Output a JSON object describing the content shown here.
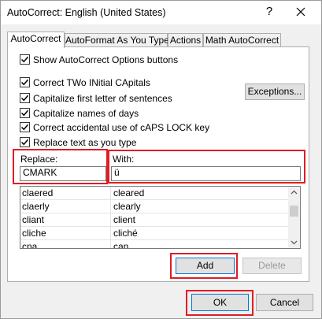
{
  "window": {
    "title": "AutoCorrect: English (United States)",
    "help_glyph": "?"
  },
  "tabs": [
    {
      "label": "AutoCorrect",
      "active": true
    },
    {
      "label": "AutoFormat As You Type",
      "active": false
    },
    {
      "label": "Actions",
      "active": false
    },
    {
      "label": "Math AutoCorrect",
      "active": false
    }
  ],
  "options": {
    "show_buttons": {
      "label": "Show AutoCorrect Options buttons",
      "checked": true
    },
    "two_initial": {
      "label": "Correct TWo INitial CApitals",
      "checked": true
    },
    "first_letter": {
      "label": "Capitalize first letter of sentences",
      "checked": true
    },
    "names_days": {
      "label": "Capitalize names of days",
      "checked": true
    },
    "caps_lock": {
      "label": "Correct accidental use of cAPS LOCK key",
      "checked": true
    },
    "replace_text": {
      "label": "Replace text as you type",
      "checked": true
    }
  },
  "buttons": {
    "exceptions": "Exceptions...",
    "add": "Add",
    "delete": "Delete",
    "ok": "OK",
    "cancel": "Cancel"
  },
  "replace": {
    "label": "Replace:",
    "value": "CMARK"
  },
  "with": {
    "label": "With:",
    "value": "ü"
  },
  "entries": [
    {
      "replace": "claered",
      "with": "cleared"
    },
    {
      "replace": "claerly",
      "with": "clearly"
    },
    {
      "replace": "cliant",
      "with": "client"
    },
    {
      "replace": "cliche",
      "with": "cliché"
    },
    {
      "replace": "cna",
      "with": "can"
    }
  ],
  "colors": {
    "highlight": "#e01c24",
    "accent": "#0078d7"
  }
}
